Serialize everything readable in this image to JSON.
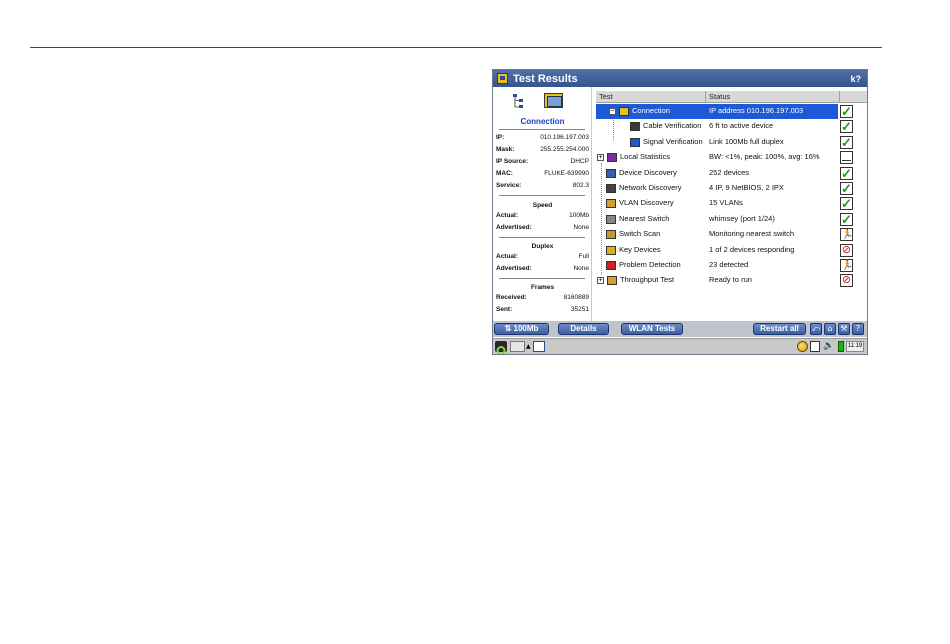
{
  "window": {
    "title": "Test Results",
    "help_glyph": "k?"
  },
  "left_panel": {
    "heading": "Connection",
    "ip": {
      "label": "IP:",
      "value": "010.196.197.003"
    },
    "mask": {
      "label": "Mask:",
      "value": "255.255.254.000"
    },
    "ip_source": {
      "label": "IP Source:",
      "value": "DHCP"
    },
    "mac": {
      "label": "MAC:",
      "value": "FLUKE-639990"
    },
    "service": {
      "label": "Service:",
      "value": "802.3"
    },
    "speed": {
      "title": "Speed",
      "actual_label": "Actual:",
      "actual": "100Mb",
      "advertised_label": "Advertised:",
      "advertised": "None"
    },
    "duplex": {
      "title": "Duplex",
      "actual_label": "Actual:",
      "actual": "Full",
      "advertised_label": "Advertised:",
      "advertised": "None"
    },
    "frames": {
      "title": "Frames",
      "received_label": "Received:",
      "received": "8160889",
      "sent_label": "Sent:",
      "sent": "35251"
    }
  },
  "table": {
    "col_test": "Test",
    "col_status": "Status",
    "rows": [
      {
        "name": "Connection",
        "status": "IP address 010.196.197.003",
        "result": "check",
        "expander": "−",
        "selected": true
      },
      {
        "name": "Cable Verification",
        "status": "6 ft to active device",
        "result": "check",
        "expander": "",
        "selected": false
      },
      {
        "name": "Signal Verification",
        "status": "Link 100Mb full duplex",
        "result": "check",
        "expander": "",
        "selected": false
      },
      {
        "name": "Local Statistics",
        "status": "BW: <1%, peak: 100%, avg: 16%",
        "result": "empty",
        "expander": "+",
        "selected": false
      },
      {
        "name": "Device Discovery",
        "status": "252 devices",
        "result": "check",
        "expander": "",
        "selected": false
      },
      {
        "name": "Network Discovery",
        "status": "4 IP, 9 NetBIOS, 2 IPX",
        "result": "check",
        "expander": "",
        "selected": false
      },
      {
        "name": "VLAN Discovery",
        "status": "15 VLANs",
        "result": "check",
        "expander": "",
        "selected": false
      },
      {
        "name": "Nearest Switch",
        "status": "whimsey (port 1/24)",
        "result": "check",
        "expander": "",
        "selected": false
      },
      {
        "name": "Switch Scan",
        "status": "Monitoring nearest switch",
        "result": "running",
        "expander": "",
        "selected": false
      },
      {
        "name": "Key Devices",
        "status": "1 of 2 devices responding",
        "result": "fail",
        "expander": "",
        "selected": false
      },
      {
        "name": "Problem Detection",
        "status": "23 detected",
        "result": "running",
        "expander": "",
        "selected": false
      },
      {
        "name": "Throughput Test",
        "status": "Ready to run",
        "result": "not-run",
        "expander": "+",
        "selected": false
      }
    ]
  },
  "bottom_bar": {
    "speed_button": "100Mb",
    "details_button": "Details",
    "wlan_button": "WLAN Tests",
    "restart_button": "Restart all"
  },
  "taskbar": {
    "clock": "11:19"
  },
  "colors": {
    "selection": "#1e59d8",
    "titlebar": "#37558a",
    "pass": "#1aa01a",
    "fail": "#e01010"
  }
}
